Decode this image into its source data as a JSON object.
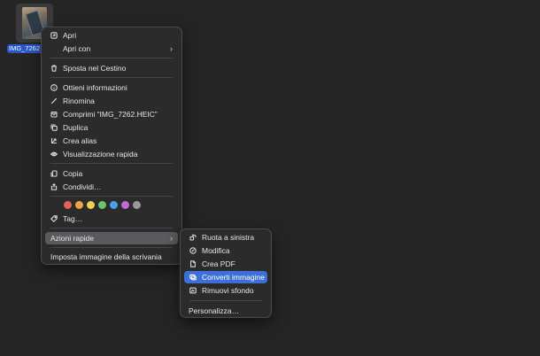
{
  "desktop": {
    "file_name": "IMG_7262"
  },
  "context_menu": {
    "items": [
      {
        "label": "Apri",
        "icon": "open-icon"
      },
      {
        "label": "Apri con",
        "icon": "",
        "arrow": "›"
      },
      {
        "label": "Sposta nel Cestino",
        "icon": "trash-icon"
      },
      {
        "label": "Ottieni informazioni",
        "icon": "info-icon"
      },
      {
        "label": "Rinomina",
        "icon": "pencil-icon"
      },
      {
        "label": "Comprimi “IMG_7262.HEIC”",
        "icon": "archive-icon"
      },
      {
        "label": "Duplica",
        "icon": "duplicate-icon"
      },
      {
        "label": "Crea alias",
        "icon": "alias-icon"
      },
      {
        "label": "Visualizzazione rapida",
        "icon": "eye-icon"
      },
      {
        "label": "Copia",
        "icon": "copy-icon"
      },
      {
        "label": "Condividi…",
        "icon": "share-icon"
      },
      {
        "label": "Tag…",
        "icon": "tag-icon"
      },
      {
        "label": "Azioni rapide",
        "icon": "",
        "arrow": "›"
      },
      {
        "label": "Imposta immagine della scrivania",
        "icon": ""
      }
    ],
    "tag_colors": [
      "#e8605a",
      "#f0a24a",
      "#f1cf55",
      "#6cc56a",
      "#4a9ff0",
      "#c06ad9",
      "#9a9a9e"
    ]
  },
  "submenu": {
    "items": [
      {
        "label": "Ruota a sinistra",
        "icon": "rotate-left-icon"
      },
      {
        "label": "Modifica",
        "icon": "markup-icon"
      },
      {
        "label": "Crea PDF",
        "icon": "pdf-icon"
      },
      {
        "label": "Converti immagine",
        "icon": "convert-image-icon"
      },
      {
        "label": "Rimuovi sfondo",
        "icon": "remove-background-icon"
      },
      {
        "label": "Personalizza…",
        "icon": ""
      }
    ]
  }
}
